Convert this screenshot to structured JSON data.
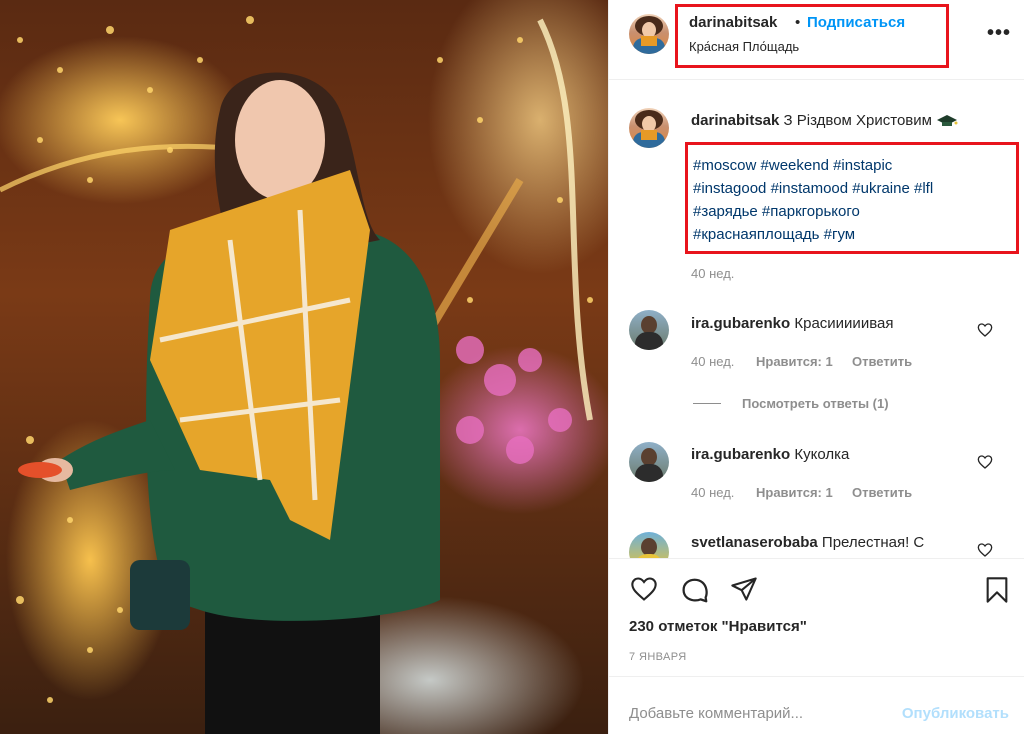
{
  "post": {
    "username": "darinabitsak",
    "separator": "•",
    "follow_label": "Подписаться",
    "location": "Кра́сная Пло́щадь",
    "more_label": "•••"
  },
  "caption": {
    "username": "darinabitsak",
    "text": "З Різдвом Христовим",
    "emoji": "cap-icon",
    "hashtag_lines": [
      "#moscow #weekend #instapic",
      "#instagood #instamood #ukraine #lfl",
      "#зарядье #паркгорького",
      "#краснаяплощадь #гум"
    ],
    "age": "40 нед."
  },
  "comments": [
    {
      "username": "ira.gubarenko",
      "text": "Красииииивая",
      "age": "40 нед.",
      "likes": "Нравится: 1",
      "reply": "Ответить",
      "view_replies": "Посмотреть ответы (1)"
    },
    {
      "username": "ira.gubarenko",
      "text": "Куколка",
      "age": "40 нед.",
      "likes": "Нравится: 1",
      "reply": "Ответить"
    },
    {
      "username": "svetlanaserobaba",
      "text": "Прелестная! С"
    }
  ],
  "actions": {
    "like_count": "230 отметок \"Нравится\"",
    "date": "7 ЯНВАРЯ",
    "comment_placeholder": "Добавьте комментарий...",
    "publish_label": "Опубликовать"
  },
  "colors": {
    "accent": "#0095f6",
    "highlight": "#e8141c",
    "hashtag": "#00376b",
    "muted": "#8e8e8e"
  }
}
